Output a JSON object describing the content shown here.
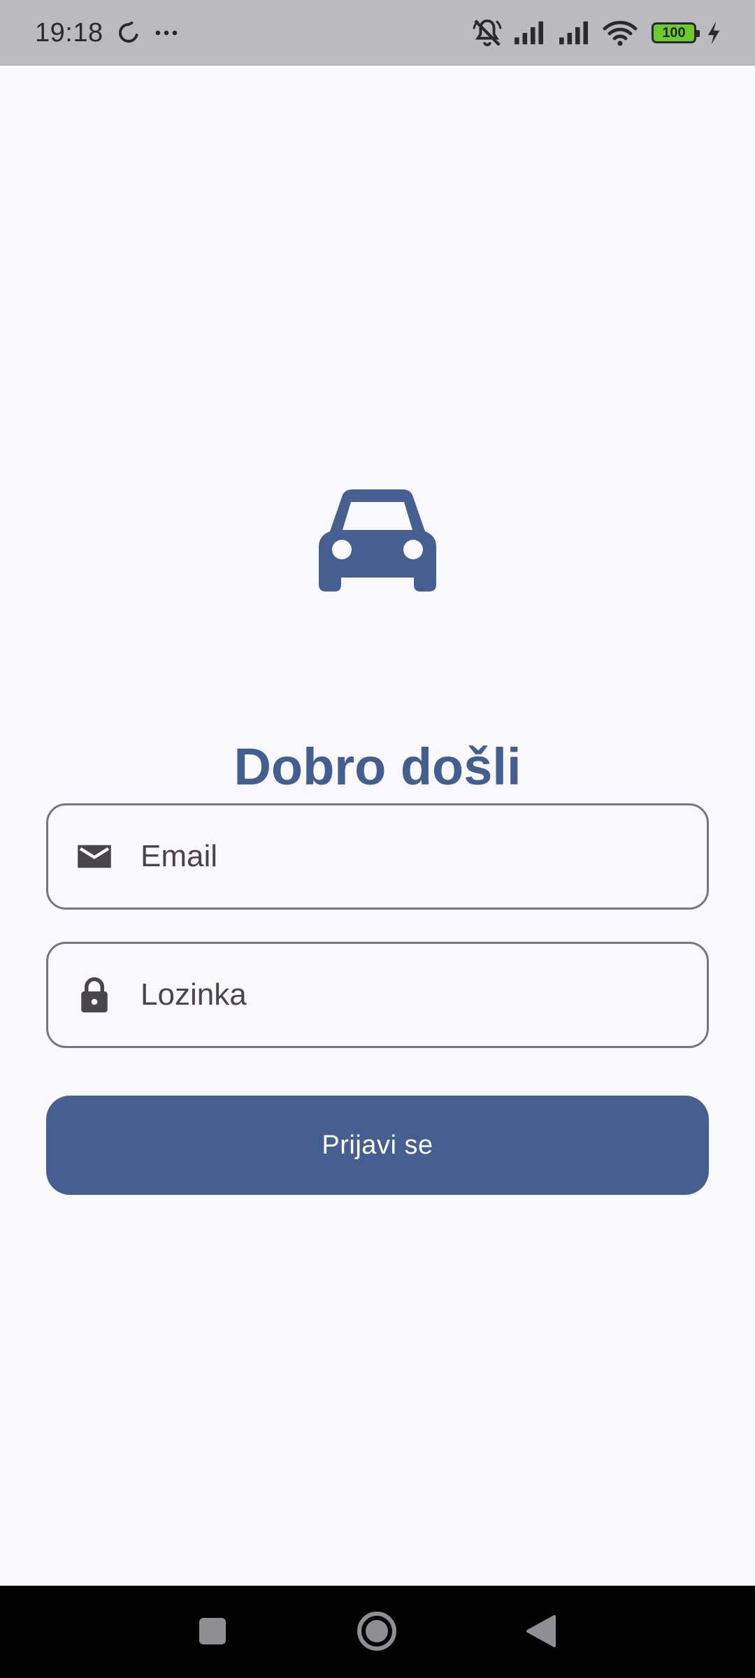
{
  "status_bar": {
    "time": "19:18",
    "battery_level": "100",
    "icons": [
      "sync-icon",
      "more-dots-icon",
      "mute-icon",
      "signal-icon",
      "signal-icon",
      "wifi-icon",
      "battery-icon",
      "charging-icon"
    ]
  },
  "login": {
    "title": "Dobro došli",
    "email": {
      "value": "",
      "placeholder": "Email",
      "icon": "email-icon"
    },
    "password": {
      "value": "",
      "placeholder": "Lozinka",
      "icon": "lock-icon"
    },
    "submit_label": "Prijavi se"
  },
  "colors": {
    "primary": "#455F91",
    "background": "#F9F8FD",
    "outline": "#77767C",
    "field_icon": "#48464C",
    "status_bar": "#BBBABF"
  },
  "nav_bar": {
    "icons": [
      "recents-icon",
      "home-icon",
      "back-icon"
    ]
  }
}
